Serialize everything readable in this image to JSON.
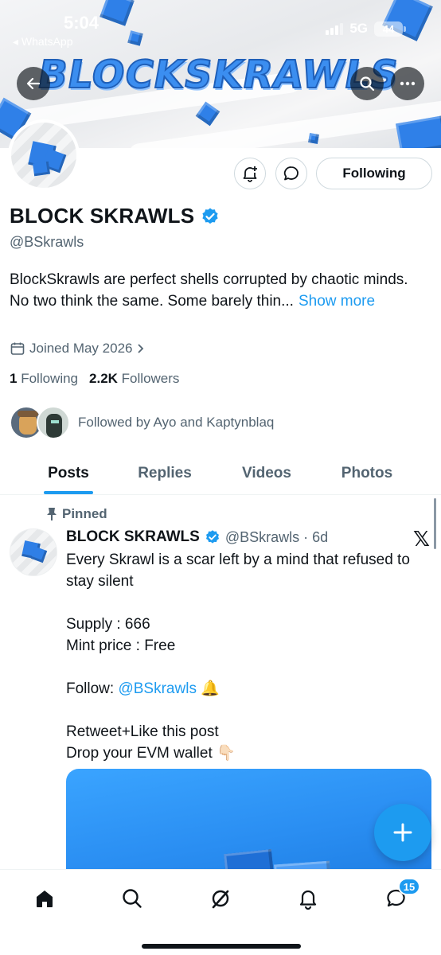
{
  "status_bar": {
    "time": "5:04",
    "back_app": "◂ WhatsApp",
    "network": "5G",
    "battery": "44"
  },
  "banner": {
    "title": "BLOCKSKRAWLS"
  },
  "profile": {
    "display_name": "BLOCK SKRAWLS",
    "handle": "@BSkrawls",
    "bio_line1": "BlockSkrawls are perfect shells corrupted by chaotic minds.",
    "bio_line2": "No two think the same. Some barely thin...",
    "show_more": "Show more",
    "joined": "Joined May 2026",
    "following_count": "1",
    "following_label": "Following",
    "followers_count": "2.2K",
    "followers_label": "Followers",
    "followed_by": "Followed by Ayo and Kaptynblaq",
    "follow_button": "Following"
  },
  "tabs": [
    {
      "label": "Posts",
      "active": true
    },
    {
      "label": "Replies",
      "active": false
    },
    {
      "label": "Videos",
      "active": false
    },
    {
      "label": "Photos",
      "active": false
    }
  ],
  "post": {
    "pinned_label": "Pinned",
    "author": "BLOCK SKRAWLS",
    "handle_time": "@BSkrawls · 6d",
    "line1": "Every Skrawl is a scar left by a mind that refused to stay silent",
    "supply": "Supply : 666",
    "mint_price": "Mint price : Free",
    "follow_prefix": "Follow: ",
    "follow_mention": "@BSkrawls",
    "follow_emoji": "🔔",
    "retweet": "Retweet+Like this post",
    "drop_wallet": "Drop your EVM wallet",
    "drop_emoji": "👇🏻",
    "x_logo": "𝕏"
  },
  "bottom_nav": {
    "items": [
      "home-icon",
      "search-icon",
      "grok-icon",
      "notifications-icon",
      "messages-icon"
    ],
    "messages_badge": "15"
  },
  "colors": {
    "accent": "#1d9bf0",
    "text_primary": "#0f1419",
    "text_secondary": "#536471"
  }
}
